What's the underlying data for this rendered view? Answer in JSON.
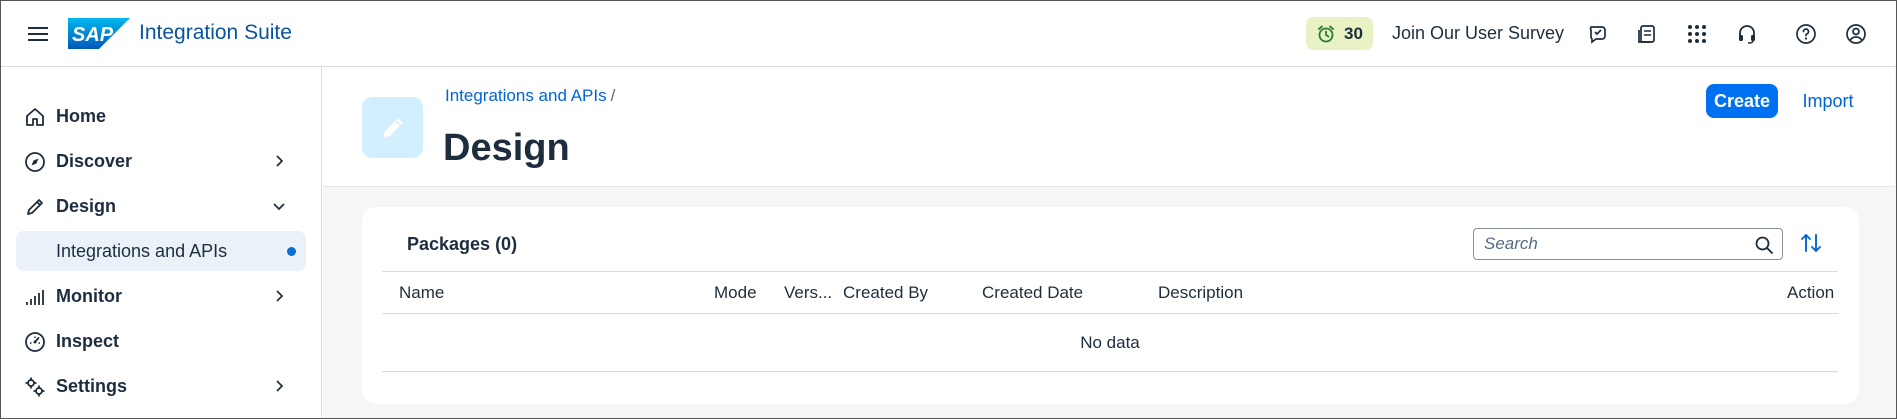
{
  "shell": {
    "brand_logo_text": "SAP",
    "app_title": "Integration Suite",
    "trial_days": "30",
    "survey_link": "Join Our User Survey",
    "icons": [
      "joule-icon",
      "notes-icon",
      "product-switch-icon",
      "support-icon",
      "help-icon",
      "user-profile-icon"
    ]
  },
  "sidebar": {
    "items": [
      {
        "label": "Home",
        "icon": "home-icon",
        "expandable": false
      },
      {
        "label": "Discover",
        "icon": "compass-icon",
        "expandable": true
      },
      {
        "label": "Design",
        "icon": "pencil-icon",
        "expandable": true,
        "expanded": true
      },
      {
        "label": "Monitor",
        "icon": "bar-chart-icon",
        "expandable": true
      },
      {
        "label": "Inspect",
        "icon": "gauge-icon",
        "expandable": false
      },
      {
        "label": "Settings",
        "icon": "gears-icon",
        "expandable": true
      }
    ],
    "sub_items": [
      {
        "label": "Integrations and APIs",
        "selected": true
      }
    ]
  },
  "header": {
    "breadcrumb": "Integrations and APIs",
    "breadcrumb_sep": "/",
    "title": "Design",
    "create_label": "Create",
    "import_label": "Import"
  },
  "packages": {
    "title": "Packages (0)",
    "search_placeholder": "Search",
    "columns": [
      "Name",
      "Mode",
      "Vers...",
      "Created By",
      "Created Date",
      "Description",
      "Action"
    ],
    "empty_text": "No data"
  },
  "colors": {
    "accent": "#0070f2",
    "link": "#0064d9",
    "trial_badge_bg": "#e8f2c4",
    "selected_nav_bg": "#eaf1f9",
    "header_icon_bg": "#d1efff"
  }
}
